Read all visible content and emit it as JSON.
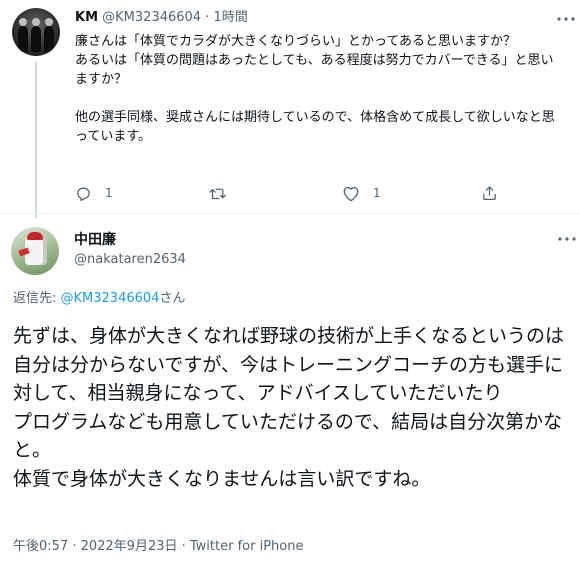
{
  "parent_tweet": {
    "author_name": "KM",
    "handle": "@KM32346604",
    "separator": "·",
    "time": "1時間",
    "text": "廉さんは「体質でカラダが大きくなりづらい」とかってあると思いますか？\nあるいは「体質の問題はあったとしても、ある程度は努力でカバーできる」と思いますか？\n\n他の選手同様、奨成さんには期待しているので、体格含めて成長して欲しいなと思っています。",
    "actions": {
      "reply_count": "1",
      "retweet_count": "",
      "like_count": "1"
    }
  },
  "main_tweet": {
    "author_name": "中田廉",
    "handle": "@nakataren2634",
    "reply_label": "返信先: ",
    "reply_handle": "@KM32346604",
    "reply_suffix": "さん",
    "text": "先ずは、身体が大きくなれば野球の技術が上手くなるというのは自分は分からないですが、今はトレーニングコーチの方も選手に対して、相当親身になって、アドバイスしていただいたり\nプログラムなども用意していただけるので、結局は自分次第かなと。\n体質で身体が大きくなりませんは言い訳ですね。",
    "meta": "午後0:57 · 2022年9月23日 · Twitter for iPhone"
  },
  "colors": {
    "text_primary": "#0f1419",
    "text_secondary": "#536471",
    "link": "#1d9bf0",
    "divider": "#eff3f4",
    "thread_line": "#cfd9de"
  },
  "icons": [
    "reply-icon",
    "retweet-icon",
    "like-icon",
    "share-icon",
    "more-icon"
  ]
}
